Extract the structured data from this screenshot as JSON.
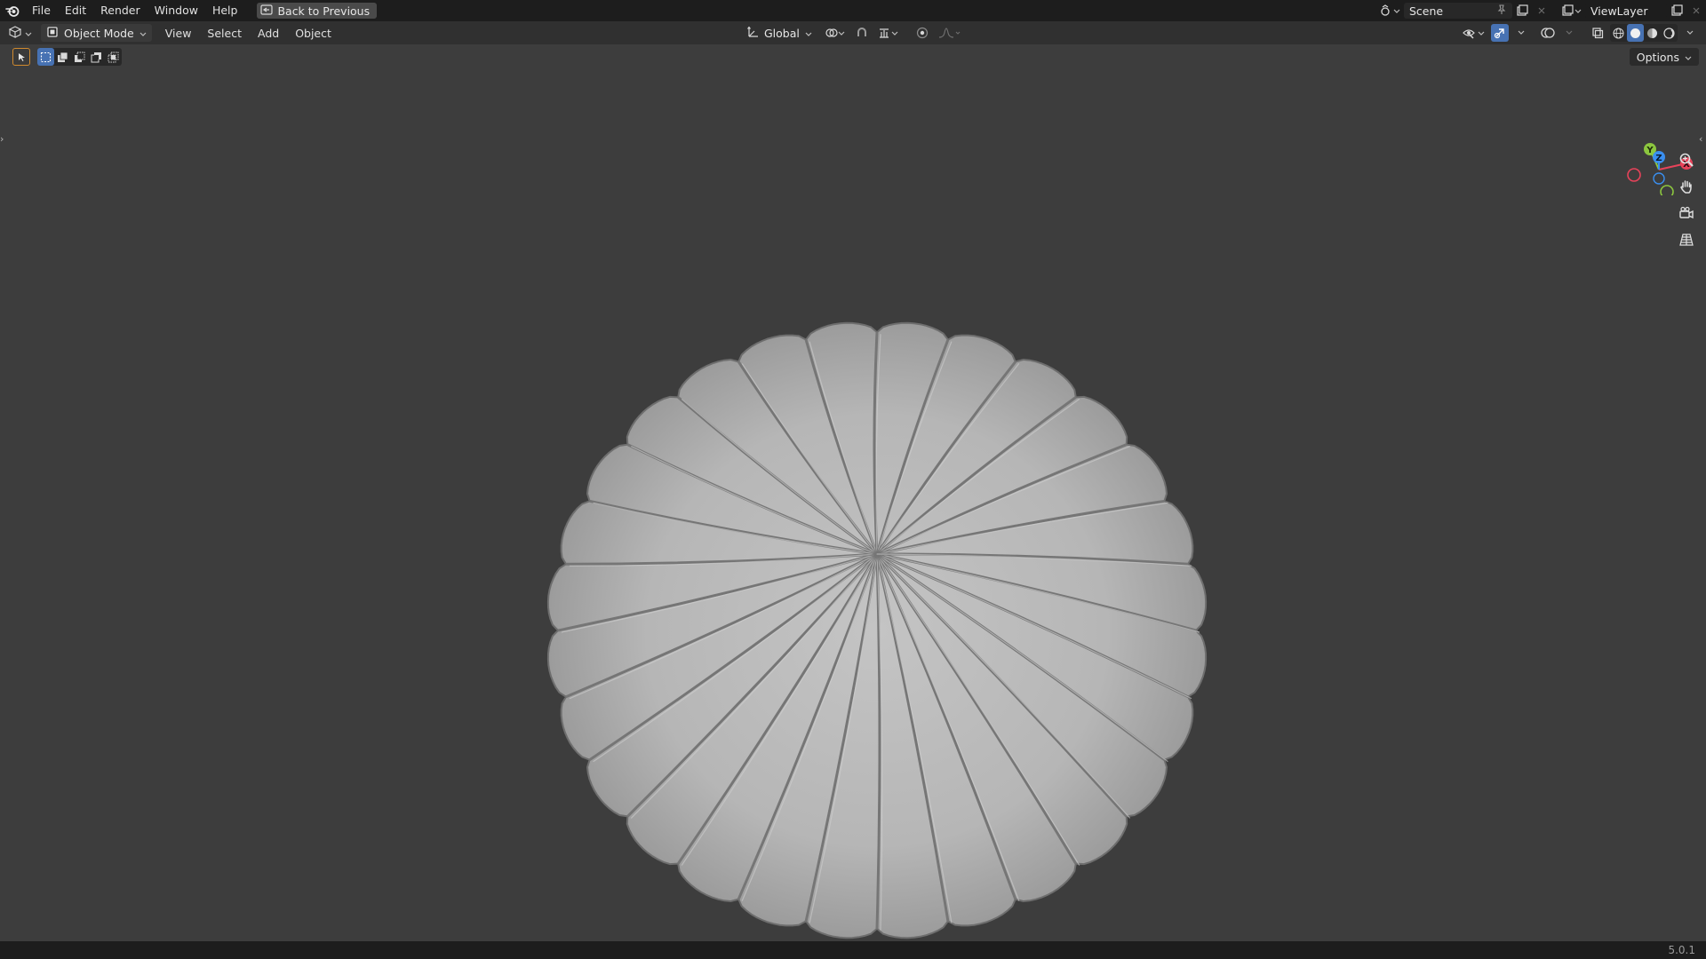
{
  "topbar": {
    "menus": [
      "File",
      "Edit",
      "Render",
      "Window",
      "Help"
    ],
    "back_label": "Back to Previous",
    "scene_name": "Scene",
    "view_layer_name": "ViewLayer",
    "icons": [
      "blender-logo-icon",
      "back-icon",
      "scene-icon",
      "pin-icon",
      "new-scene-icon",
      "close-icon",
      "view-layer-icon",
      "new-view-layer-icon"
    ]
  },
  "header": {
    "mode_label": "Object Mode",
    "menus": [
      "View",
      "Select",
      "Add",
      "Object"
    ],
    "transform_orientation": "Global",
    "colors": {
      "accent": "#4772b3",
      "header_bg": "#303030",
      "viewport_bg": "#3d3d3d"
    }
  },
  "tool_settings": {
    "options_label": "Options",
    "active_selection_mode": 0
  },
  "viewport": {
    "gizmo_axes": [
      "X",
      "Y",
      "Z"
    ],
    "axis_colors": {
      "x": "#e8435a",
      "y": "#8cc63f",
      "z": "#3a8ff0"
    },
    "object": {
      "type": "fluted-disc",
      "segments": 28,
      "color": "#b8b8b8"
    }
  },
  "statusbar": {
    "version": "5.0.1"
  }
}
